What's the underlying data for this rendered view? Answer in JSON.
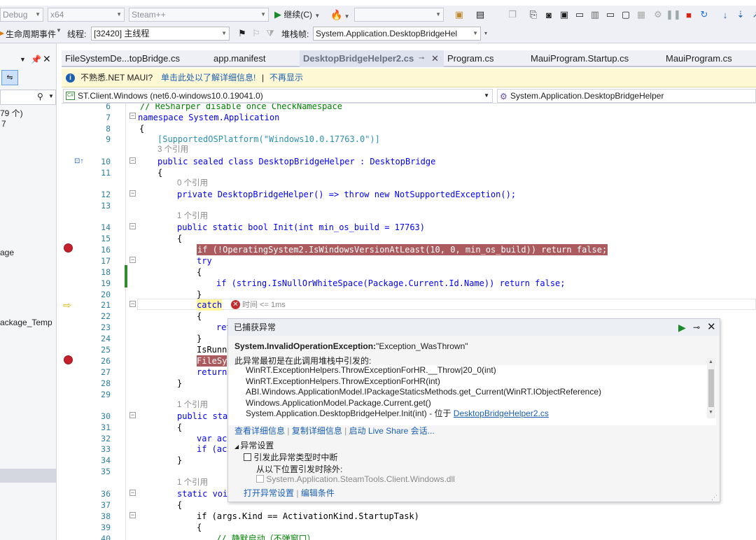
{
  "toolbar": {
    "config_combo": "Debug",
    "platform_combo": "x64",
    "startup_combo": "Steam++",
    "continue_label": "继续(C)",
    "empty_combo": ""
  },
  "toolbar2": {
    "lifecycle_label": "生命周期事件",
    "thread_label": "线程:",
    "thread_value": "[32420] 主线程",
    "stackframe_label": "堆栈帧:",
    "stackframe_value": "System.Application.DesktopBridgeHel"
  },
  "left_panel": {
    "count_text": "79 个)",
    "count_num": "7",
    "item1": "age",
    "item2": "ackage_Temp"
  },
  "tabs": [
    {
      "label": "FileSystemDe...topBridge.cs"
    },
    {
      "label": "app.manifest"
    },
    {
      "label": "DesktopBridgeHelper2.cs"
    },
    {
      "label": "Program.cs"
    },
    {
      "label": "MauiProgram.Startup.cs"
    },
    {
      "label": "MauiProgram.cs"
    }
  ],
  "infobar": {
    "text": "不熟悉.NET MAUI?",
    "link": "单击此处以了解详细信息!",
    "sep": "|",
    "dismiss": "不再显示"
  },
  "navbar": {
    "project": "ST.Client.Windows (net6.0-windows10.0.19041.0)",
    "type": "System.Application.DesktopBridgeHelper"
  },
  "code_lines": [
    {
      "n": "6",
      "text": "// ReSharper disable once CheckNamespace"
    },
    {
      "n": "7",
      "text": "namespace System.Application"
    },
    {
      "n": "8",
      "text": "{"
    },
    {
      "n": "9",
      "text": "[SupportedOSPlatform(\"Windows10.0.17763.0\")]"
    },
    {
      "n": "10",
      "text": "public sealed class DesktopBridgeHelper : DesktopBridge"
    },
    {
      "n": "11",
      "text": "{"
    },
    {
      "n": "12",
      "text": "private DesktopBridgeHelper() => throw new NotSupportedException();"
    },
    {
      "n": "13",
      "text": ""
    },
    {
      "n": "14",
      "text": "public static bool Init(int min_os_build = 17763)"
    },
    {
      "n": "15",
      "text": "{"
    },
    {
      "n": "16",
      "text": "if (!OperatingSystem2.IsWindowsVersionAtLeast(10, 0, min_os_build)) return false;"
    },
    {
      "n": "17",
      "text": "try"
    },
    {
      "n": "18",
      "text": "{"
    },
    {
      "n": "19",
      "text": "if (string.IsNullOrWhiteSpace(Package.Current.Id.Name)) return false;"
    },
    {
      "n": "20",
      "text": "}"
    },
    {
      "n": "21",
      "text": "catch"
    },
    {
      "n": "22",
      "text": "{"
    },
    {
      "n": "23",
      "text": "ret"
    },
    {
      "n": "24",
      "text": "}"
    },
    {
      "n": "25",
      "text": "IsRunn"
    },
    {
      "n": "26",
      "text": "FileSy"
    },
    {
      "n": "27",
      "text": "return"
    },
    {
      "n": "28",
      "text": "}"
    },
    {
      "n": "29",
      "text": ""
    },
    {
      "n": "30",
      "text": "public sta"
    },
    {
      "n": "31",
      "text": "{"
    },
    {
      "n": "32",
      "text": "var act"
    },
    {
      "n": "33",
      "text": "if (act"
    },
    {
      "n": "34",
      "text": "}"
    },
    {
      "n": "35",
      "text": ""
    },
    {
      "n": "36",
      "text": "static voi"
    },
    {
      "n": "37",
      "text": "{"
    },
    {
      "n": "38",
      "text": "if (args.Kind == ActivationKind.StartupTask)"
    },
    {
      "n": "39",
      "text": "{"
    },
    {
      "n": "40",
      "text": "// 静默启动（不弹窗口）"
    }
  ],
  "refs": {
    "r3": "3 个引用",
    "r0": "0 个引用",
    "r1a": "1 个引用",
    "r1b": "1 个引用",
    "r1c": "1 个引用"
  },
  "elapsed": "时间 <= 1ms",
  "popup": {
    "title": "已捕获异常",
    "exception_type": "System.InvalidOperationException:",
    "exception_message": "\"Exception_WasThrown\"",
    "origin_text": "此异常最初是在此调用堆栈中引发的:",
    "stack": [
      "WinRT.ExceptionHelpers.ThrowExceptionForHR.__Throw|20_0(int)",
      "WinRT.ExceptionHelpers.ThrowExceptionForHR(int)",
      "ABI.Windows.ApplicationModel.IPackageStaticsMethods.get_Current(WinRT.IObjectReference)",
      "Windows.ApplicationModel.Package.Current.get()",
      "System.Application.DesktopBridgeHelper.Init(int) - 位于 "
    ],
    "stack_file_link": "DesktopBridgeHelper2.cs",
    "view_details": "查看详细信息",
    "copy_details": "复制详细信息",
    "live_share": "启动 Live Share 会话...",
    "settings_header": "异常设置",
    "break_when": "引发此异常类型时中断",
    "except_from": "从以下位置引发时除外:",
    "except_item": "System.Application.SteamTools.Client.Windows.dll",
    "open_settings": "打开异常设置",
    "edit_conditions": "编辑条件"
  }
}
